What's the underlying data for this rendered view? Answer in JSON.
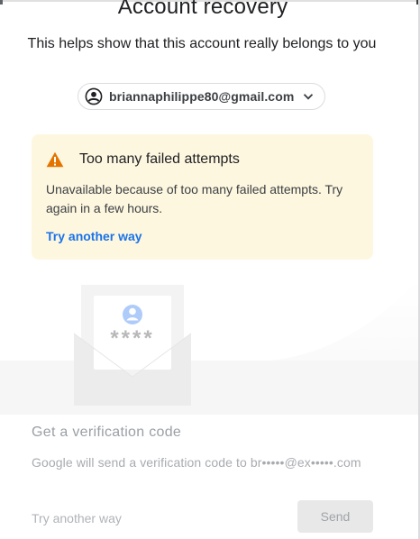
{
  "header": {
    "title": "Account recovery",
    "subtitle": "This helps show that this account really belongs to you"
  },
  "account": {
    "email": "briannaphilippe80@gmail.com",
    "avatar_icon": "account-circle-icon",
    "dropdown_icon": "chevron-down-icon"
  },
  "alert": {
    "icon": "warning-icon",
    "title": "Too many failed attempts",
    "body": "Unavailable because of too many failed attempts. Try again in a few hours.",
    "link": "Try another way"
  },
  "illustration": {
    "masked_text": "****"
  },
  "verification": {
    "title": "Get a verification code",
    "description": "Google will send a verification code to br•••••@ex•••••.com",
    "try_another": "Try another way",
    "send_label": "Send"
  },
  "colors": {
    "alert_bg": "#fef7e0",
    "warning": "#e37400",
    "link": "#1a73e8",
    "disabled_text": "#9aa0a6"
  }
}
